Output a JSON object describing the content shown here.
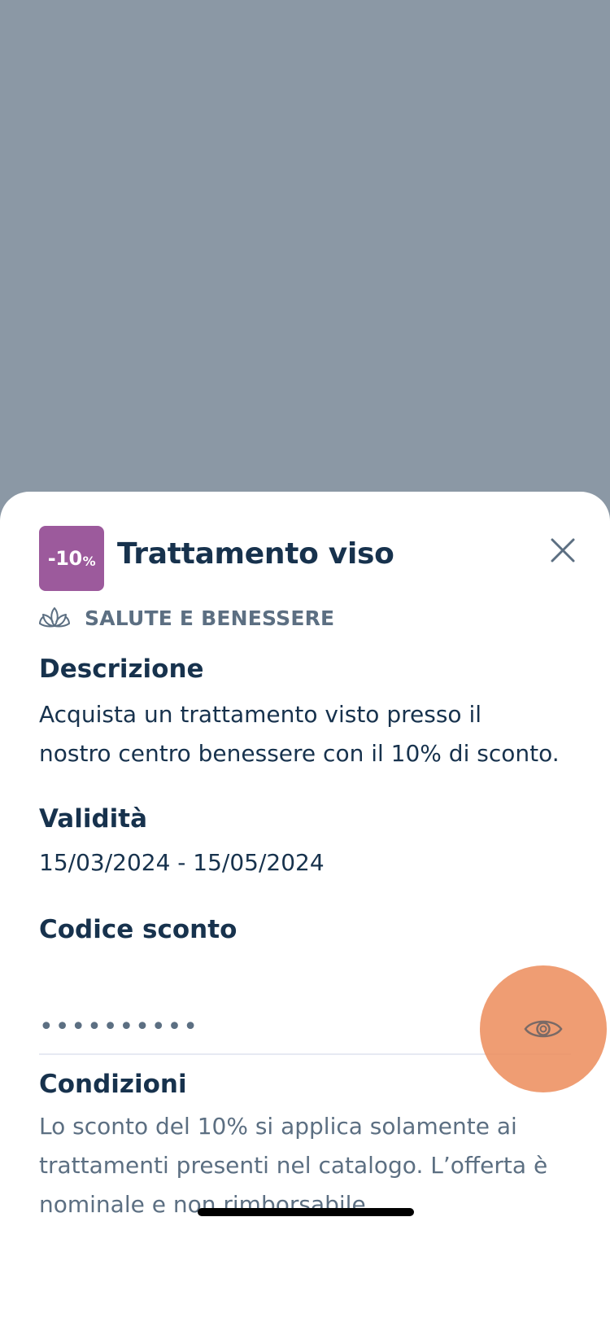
{
  "offer": {
    "badge_value": "-10",
    "badge_unit": "%",
    "title": "Trattamento viso",
    "category_icon": "lotus-icon",
    "category": "SALUTE E BENESSERE"
  },
  "sections": {
    "description": {
      "heading": "Descrizione",
      "text": "Acquista un trattamento visto presso il nostro centro benessere con il 10% di sconto."
    },
    "validity": {
      "heading": "Validità",
      "text": "15/03/2024 - 15/05/2024"
    },
    "discount_code": {
      "heading": "Codice sconto",
      "value": "••••••••••",
      "toggle_icon": "eye-icon"
    },
    "conditions": {
      "heading": "Condizioni",
      "text": "Lo sconto del 10% si applica solamente ai trattamenti presenti nel catalogo. L’offerta è nominale e non rimborsabile."
    }
  },
  "colors": {
    "overlay": "#8b98a5",
    "badge": "#9c5a9c",
    "primary_text": "#17324d",
    "secondary_text": "#5c6f82",
    "fab": "#ec8c5a"
  }
}
